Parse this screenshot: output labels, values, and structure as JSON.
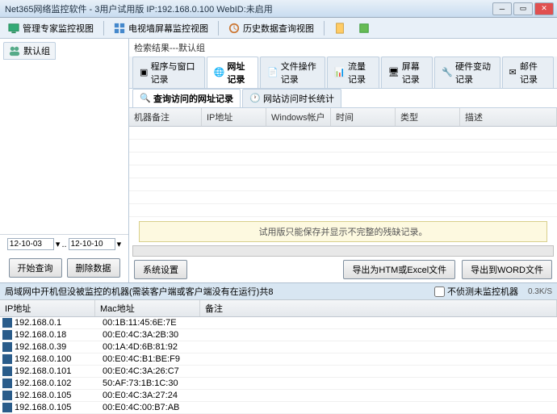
{
  "title": "Net365网络监控软件 - 3用户试用版 IP:192.168.0.100 WebID:未启用",
  "toolbar": {
    "mgrview": "管理专家监控视图",
    "tvwall": "电视墙屏幕监控视图",
    "history": "历史数据查询视图"
  },
  "sidebar": {
    "tab": "默认组",
    "date_from": "12-10-03",
    "date_sep": "..",
    "date_to": "12-10-10",
    "btn_query": "开始查询",
    "btn_delete": "删除数据"
  },
  "content": {
    "crumb": "检索结果---默认组",
    "tabs": [
      "程序与窗口记录",
      "网址记录",
      "文件操作记录",
      "流量记录",
      "屏幕记录",
      "硬件变动记录",
      "邮件记录"
    ],
    "tabs2": [
      "查询访问的网址记录",
      "网站访问时长统计"
    ],
    "cols": [
      "机器备注",
      "IP地址",
      "Windows帐户",
      "时间",
      "类型",
      "描述"
    ],
    "warn": "试用版只能保存并显示不完整的残缺记录。",
    "btn_settings": "系统设置",
    "btn_export_excel": "导出为HTM或Excel文件",
    "btn_export_word": "导出到WORD文件"
  },
  "lower": {
    "header": "局域网中开机但没被监控的机器(需装客户端或客户端没有在运行)共8",
    "chk_label": "不侦测未监控机器",
    "speed": "0.3K/S",
    "cols": [
      "IP地址",
      "Mac地址",
      "备注"
    ],
    "rows": [
      {
        "ip": "192.168.0.1",
        "mac": "00:1B:11:45:6E:7E"
      },
      {
        "ip": "192.168.0.18",
        "mac": "00:E0:4C:3A:2B:30"
      },
      {
        "ip": "192.168.0.39",
        "mac": "00:1A:4D:6B:81:92"
      },
      {
        "ip": "192.168.0.100",
        "mac": "00:E0:4C:B1:BE:F9"
      },
      {
        "ip": "192.168.0.101",
        "mac": "00:E0:4C:3A:26:C7"
      },
      {
        "ip": "192.168.0.102",
        "mac": "50:AF:73:1B:1C:30"
      },
      {
        "ip": "192.168.0.105",
        "mac": "00:E0:4C:3A:27:24"
      },
      {
        "ip": "192.168.0.105",
        "mac": "00:E0:4C:00:B7:AB"
      }
    ]
  }
}
